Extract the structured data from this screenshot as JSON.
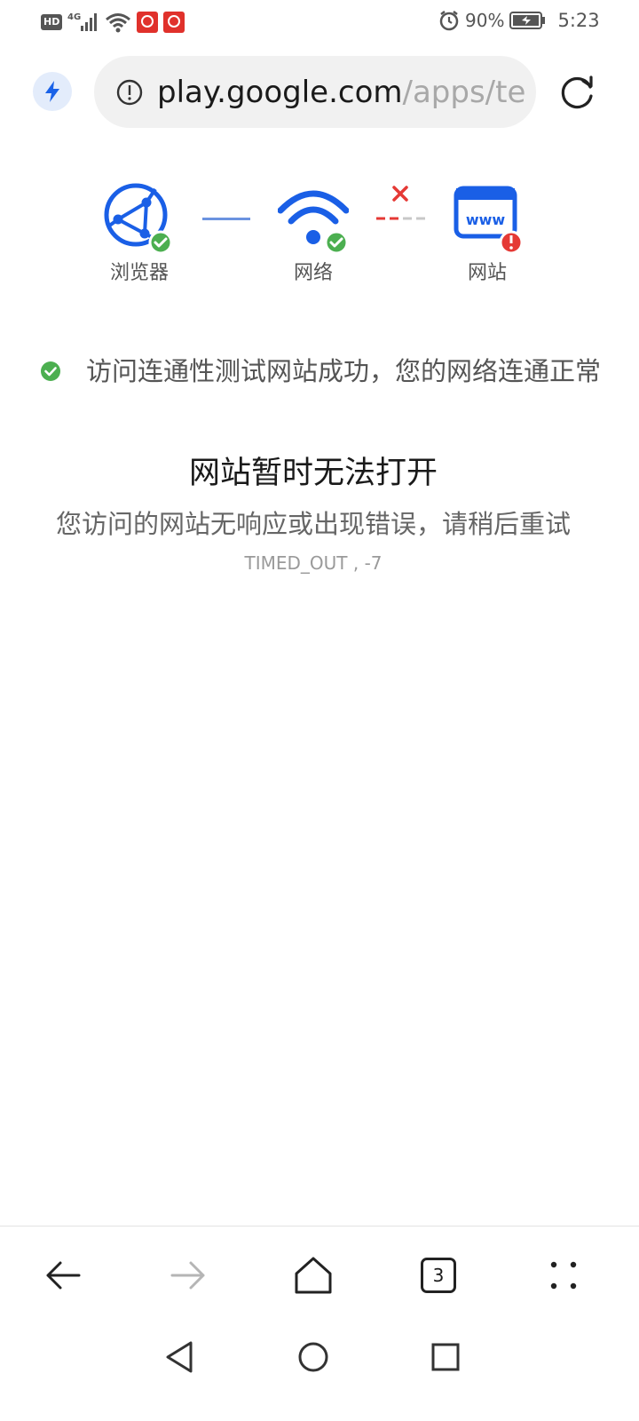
{
  "status_bar": {
    "hd": "HD",
    "network": "4G",
    "battery_percent": "90%",
    "time": "5:23",
    "icons": [
      "hd-icon",
      "signal-icon",
      "wifi-icon",
      "notification-icon",
      "notification-icon",
      "alarm-icon",
      "battery-icon"
    ]
  },
  "address_bar": {
    "url_domain": "play.google.com",
    "url_path": "/apps/tes",
    "icons": [
      "speed-mode-icon",
      "info-icon",
      "reload-icon"
    ],
    "accent": "#1a62e8"
  },
  "diagnostics": {
    "steps": [
      {
        "label": "浏览器",
        "icon": "browser-icon",
        "status": "ok"
      },
      {
        "label": "网络",
        "icon": "wifi-icon",
        "status": "ok"
      },
      {
        "label": "网站",
        "icon": "website-icon",
        "status": "error"
      }
    ],
    "colors": {
      "ok": "#4caf50",
      "error": "#e53935",
      "icon": "#1a5fe6"
    }
  },
  "messages": {
    "connectivity_ok": "访问连通性测试网站成功，您的网络连通正常",
    "title": "网站暂时无法打开",
    "subtitle": "您访问的网站无响应或出现错误，请稍后重试",
    "error_code": "TIMED_OUT , -7"
  },
  "toolbar": {
    "tab_count": "3",
    "icons": [
      "back-arrow-icon",
      "forward-arrow-icon",
      "home-icon",
      "tabs-icon",
      "menu-dots-icon"
    ]
  },
  "system_nav": {
    "icons": [
      "nav-back-icon",
      "nav-home-icon",
      "nav-recents-icon"
    ]
  }
}
